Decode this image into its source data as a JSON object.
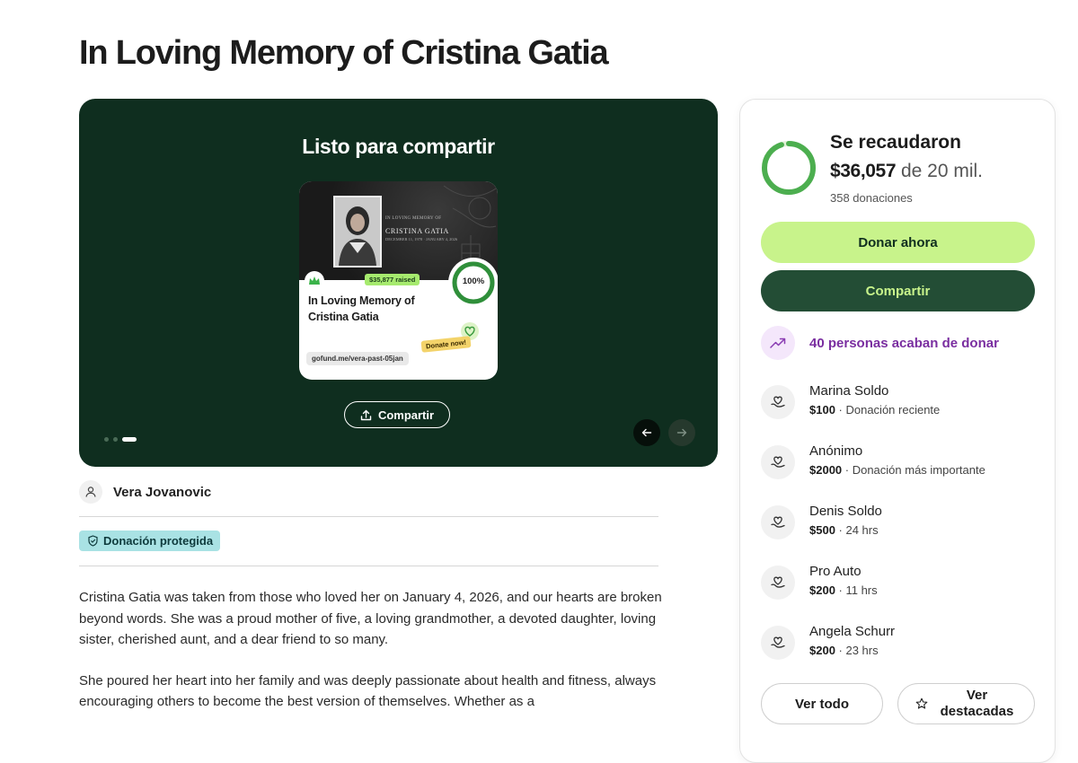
{
  "page": {
    "title": "In Loving Memory of Cristina Gatia"
  },
  "hero": {
    "heading": "Listo para compartir",
    "share_label": "Compartir",
    "card": {
      "banner_small": "IN LOVING MEMORY OF",
      "banner_name": "CRISTINA GATIA",
      "banner_dates": "DECEMBER 11, 1978 · JANUARY 4, 2026",
      "raised_pill": "$35,877 raised",
      "percent": "100%",
      "title": "In Loving Memory of Cristina Gatia",
      "donate_pill": "Donate now!",
      "url": "gofund.me/vera-past-05jan"
    },
    "slide_count": 3,
    "active_slide": 3
  },
  "organizer": {
    "name": "Vera Jovanovic"
  },
  "badge": {
    "label": "Donación protegida"
  },
  "story": {
    "paragraphs": [
      "Cristina Gatia was taken from those who loved her on January 4, 2026, and our hearts are broken beyond words. She was a proud mother of five, a loving grandmother, a devoted daughter, loving sister, cherished aunt, and a dear friend to so many.",
      "She poured her heart into her family and was deeply passionate about health and fitness, always encouraging others to become the best version of themselves. Whether as a"
    ]
  },
  "sidebar": {
    "raised_label": "Se recaudaron",
    "raised_amount": "$36,057",
    "goal_text": "de 20 mil.",
    "donations_count": "358 donaciones",
    "progress_fraction": 0.95,
    "donate_button": "Donar ahora",
    "share_button": "Compartir",
    "trend_text": "40 personas acaban de donar",
    "donors": [
      {
        "name": "Marina Soldo",
        "amount": "$100",
        "note": " · Donación reciente"
      },
      {
        "name": "Anónimo",
        "amount": "$2000",
        "note": " · Donación más importante"
      },
      {
        "name": "Denis Soldo",
        "amount": "$500",
        "note": " · 24 hrs"
      },
      {
        "name": "Pro Auto",
        "amount": "$200",
        "note": " · 11 hrs"
      },
      {
        "name": "Angela Schurr",
        "amount": "$200",
        "note": " · 23 hrs"
      }
    ],
    "see_all_button": "Ver todo",
    "see_top_button": "Ver destacadas"
  },
  "colors": {
    "hero_bg": "#0f2e1f",
    "donate_button": "#c8f38b",
    "share_button": "#234d35",
    "progress": "#4cae4f",
    "trend": "#7a2ea0",
    "badge_bg": "#a9e2e4"
  },
  "icons": {
    "share": "upload-arrow-icon",
    "prev": "arrow-left-icon",
    "next": "arrow-right-icon",
    "organizer": "person-icon",
    "badge": "shield-check-icon",
    "trend": "trending-up-icon",
    "donor": "heart-hand-icon",
    "featured": "star-icon"
  }
}
